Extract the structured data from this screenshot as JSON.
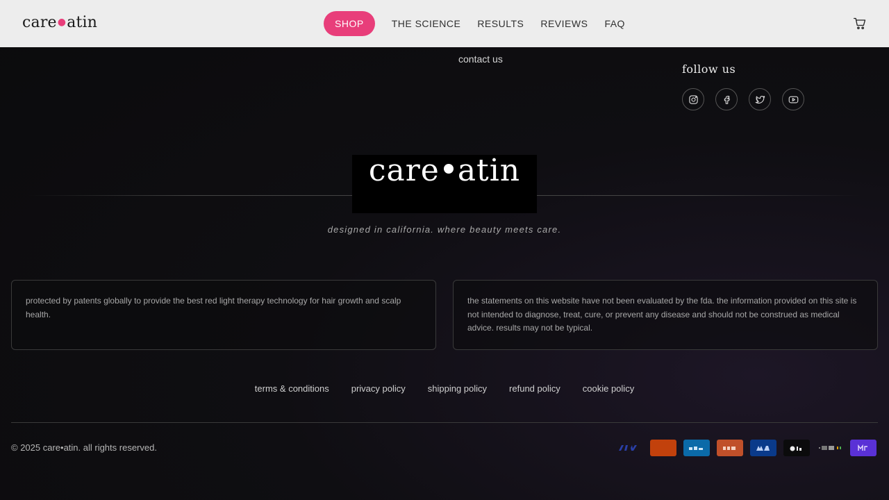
{
  "header": {
    "brand_left": "care",
    "brand_right": "atin",
    "nav": [
      {
        "label": "SHOP"
      },
      {
        "label": "THE SCIENCE"
      },
      {
        "label": "RESULTS"
      },
      {
        "label": "REVIEWS"
      },
      {
        "label": "FAQ"
      }
    ],
    "cart_icon": "cart-icon"
  },
  "footer": {
    "contact_link": "contact us",
    "follow_title": "follow us",
    "socials": [
      "instagram-icon",
      "facebook-icon",
      "twitter-icon",
      "youtube-icon"
    ],
    "logo_left": "care",
    "logo_right": "atin",
    "tagline": "designed in california. where beauty meets care.",
    "notice_left": "protected by patents globally to provide the best red light therapy technology for hair growth and scalp health.",
    "notice_right": "the statements on this website have not been evaluated by the fda. the information provided on this site is not intended to diagnose, treat, cure, or prevent any disease and should not be construed as medical advice. results may not be typical.",
    "legal_links": [
      {
        "label": "terms & conditions"
      },
      {
        "label": "privacy policy"
      },
      {
        "label": "shipping policy"
      },
      {
        "label": "refund policy"
      },
      {
        "label": "cookie policy"
      }
    ],
    "copyright": "© 2025 care•atin. all rights reserved.",
    "payments": [
      {
        "name": "visa",
        "color": "#1a1f71"
      },
      {
        "name": "mastercard",
        "color": "#c2410c"
      },
      {
        "name": "amex",
        "color": "#0b6aa8"
      },
      {
        "name": "discover",
        "color": "#c0502a"
      },
      {
        "name": "diners",
        "color": "#0a3a8a"
      },
      {
        "name": "apple-pay",
        "color": "#0b0b0c"
      },
      {
        "name": "google-pay",
        "color": "#1c1c1c"
      },
      {
        "name": "shop-pay",
        "color": "#5a31d6"
      }
    ]
  },
  "colors": {
    "accent": "#e83e7a",
    "header_bg": "#f5f5f5",
    "footer_bg": "#0f0e12"
  }
}
